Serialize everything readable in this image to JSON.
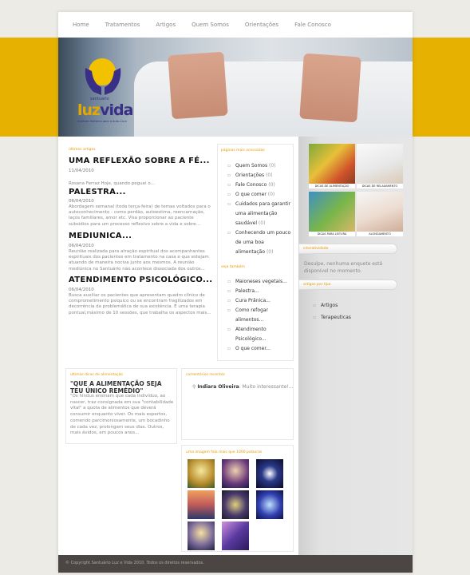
{
  "nav": [
    "Home",
    "Tratamentos",
    "Artigos",
    "Quem Somos",
    "Orientações",
    "Fale Conosco"
  ],
  "logo": {
    "small": "santuario",
    "luz": "luz",
    "vida": "vida",
    "sub": "Instituto Holístico para a Auto-Cura"
  },
  "ultimos": {
    "label": "últimos artigos",
    "posts": [
      {
        "title": "UMA REFLEXÃO SOBRE A FÉ...",
        "date": "11/04/2010",
        "excerpt": "Rosana Ferraz Hoje, quando peguei o..."
      },
      {
        "title": "PALESTRA...",
        "date": "06/04/2010",
        "excerpt": "Abordagem semanal (toda terça-feira) de temas voltados para o autoconhecimento  - como perdão, autoestima, reencarnação, laços familiares, amor etc. Visa proporcionar ao paciente subsídios para um processo reflexivo sobre a vida e sobre..."
      },
      {
        "title": "MEDIUNICA...",
        "date": "06/04/2010",
        "excerpt": " Reunião realizada para atração espiritual dos acompanhantes espirituais dos pacientes em tratamento na casa e que estejam atuando de maneira  nociva junto aos mesmos. A reunião mediúnica no Santuário não acontece dissociada dos outros..."
      },
      {
        "title": "ATENDIMENTO PSICOLÓGICO...",
        "date": "06/04/2010",
        "excerpt": "  Busca auxiliar os pacientes que apresentam quadro clínico de comprometimento psíquico ou se encontram fragilizados em decorrência da problemática de sua existência. É uma terapia pontual,máximo de 10 sessões, que trabalha os aspectos mais..."
      }
    ]
  },
  "paginas": {
    "label": "páginas mais acessadas",
    "items": [
      {
        "text": "Quem Somos",
        "count": "(0)"
      },
      {
        "text": "Orientações",
        "count": "(0)"
      },
      {
        "text": "Fale Conosco",
        "count": "(0)"
      },
      {
        "text": "O que comer",
        "count": "(0)"
      },
      {
        "text": "Cuidados para garantir uma alimentação saudável",
        "count": "(0)"
      },
      {
        "text": "Conhecendo um pouco de uma boa alimentação",
        "count": "(0)"
      }
    ]
  },
  "veja": {
    "label": "veja também",
    "items": [
      "Maioneses vegetais...",
      "Palestra...",
      "Cura Prânica...",
      "Como refogar alimentos...",
      "Atendimento Psicológico...",
      "O que comer..."
    ]
  },
  "dicas": {
    "label": "últimas dicas de alimentação",
    "title": "\"QUE A ALIMENTAÇÃO SEJA TEU ÚNICO REMÉDIO\"",
    "excerpt": "\"Os hindus ensinam que cada indivíduo, ao nascer, traz consignada em sua \"contabilidade vital\" a quota de alimentos que deverá consumir enquanto viver. Os mais espertos, comendo parcimoniosamente, um bocadinho de cada vez, prolongam seus dias. Outros, mais ávidos, em poucos anos..."
  },
  "comentarios": {
    "label": "comentários recentes",
    "author": "Indiara Oliveira",
    "text": ": Muito interessante!..."
  },
  "galeria": {
    "label": "uma imagem fala mais que 1000 palavras"
  },
  "thumbs": [
    "DICAS DE ALIMENTAÇÃO",
    "DICAS DE RELAXAMENTO",
    "DICAS PARA LEITURA",
    "ALONGAMENTO"
  ],
  "interatividade": {
    "label": "interatividade",
    "text": "Desulpe, nenhuma enquete está disponível no momento."
  },
  "artigos_tipo": {
    "label": "artigos por tipo",
    "items": [
      "Artigos",
      "Terapeuticas"
    ]
  },
  "footer": "© Copyright Santuário Luz e Vida 2010. Todos os direitos reservados.",
  "colors": {
    "accent": "#e69a00",
    "band": "#e6b100",
    "logo_blue": "#3a2f86"
  }
}
